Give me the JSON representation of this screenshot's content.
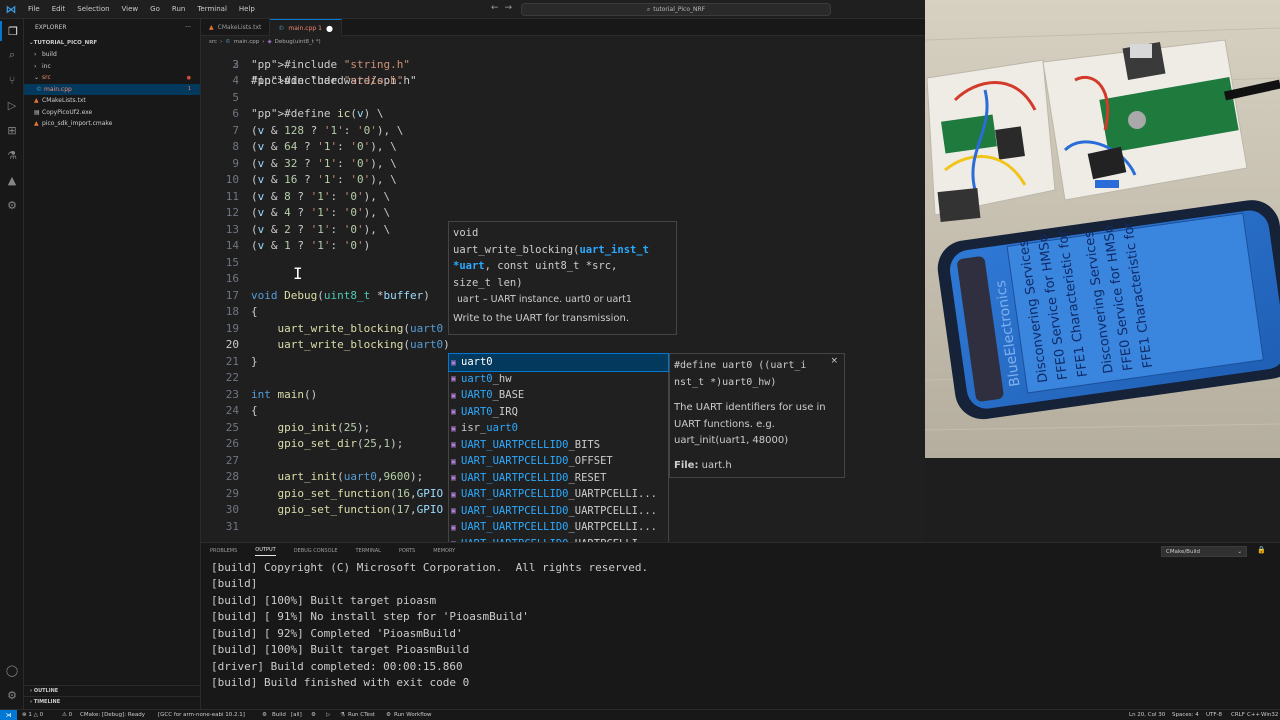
{
  "titlebar": {
    "menu": [
      "File",
      "Edit",
      "Selection",
      "View",
      "Go",
      "Run",
      "Terminal",
      "Help"
    ],
    "search": "tutorial_Pico_NRF"
  },
  "activity_icons": [
    "explorer-icon",
    "search-icon",
    "source-control-icon",
    "run-debug-icon",
    "extensions-icon",
    "testing-icon",
    "cmake-icon",
    "remote-icon"
  ],
  "sidebar": {
    "header": "EXPLORER",
    "project": "TUTORIAL_PICO_NRF",
    "items": [
      {
        "label": "build",
        "type": "folder",
        "depth": 1,
        "open": false
      },
      {
        "label": "inc",
        "type": "folder",
        "depth": 1,
        "open": false
      },
      {
        "label": "src",
        "type": "folder",
        "depth": 1,
        "open": true,
        "error": true
      },
      {
        "label": "main.cpp",
        "type": "file",
        "depth": 2,
        "selected": true,
        "error_count": "1"
      },
      {
        "label": "CMakeLists.txt",
        "type": "file",
        "depth": 1
      },
      {
        "label": "CopyPicoUf2.exe",
        "type": "file",
        "depth": 1
      },
      {
        "label": "pico_sdk_import.cmake",
        "type": "file",
        "depth": 1
      }
    ],
    "outline": "OUTLINE",
    "timeline": "TIMELINE"
  },
  "tabs": [
    {
      "label": "CMakeLists.txt",
      "active": false
    },
    {
      "label": "main.cpp 1",
      "active": true,
      "modified": true
    }
  ],
  "breadcrumb": [
    "src",
    "main.cpp",
    "Debug(uint8_t *)"
  ],
  "editor": {
    "first_line_partial": "#include \"hardware/spi.h\"",
    "lines": [
      {
        "n": "3",
        "t": "#include \"string.h\""
      },
      {
        "n": "4",
        "t": "#include \"stdio.h\""
      },
      {
        "n": "5",
        "t": ""
      },
      {
        "n": "6",
        "t": "#define ic(v) \\"
      },
      {
        "n": "7",
        "t": "(v & 128 ? '1': '0'), \\"
      },
      {
        "n": "8",
        "t": "(v & 64 ? '1': '0'), \\"
      },
      {
        "n": "9",
        "t": "(v & 32 ? '1': '0'), \\"
      },
      {
        "n": "10",
        "t": "(v & 16 ? '1': '0'), \\"
      },
      {
        "n": "11",
        "t": "(v & 8 ? '1': '0'), \\"
      },
      {
        "n": "12",
        "t": "(v & 4 ? '1': '0'), \\"
      },
      {
        "n": "13",
        "t": "(v & 2 ? '1': '0'), \\"
      },
      {
        "n": "14",
        "t": "(v & 1 ? '1': '0')"
      },
      {
        "n": "15",
        "t": ""
      },
      {
        "n": "16",
        "t": ""
      },
      {
        "n": "17",
        "t": "void Debug(uint8_t *buffer)"
      },
      {
        "n": "18",
        "t": "{"
      },
      {
        "n": "19",
        "t": "    uart_write_blocking(uart0                         1);"
      },
      {
        "n": "20",
        "t": "    uart_write_blocking(uart0)"
      },
      {
        "n": "21",
        "t": "}"
      },
      {
        "n": "22",
        "t": ""
      },
      {
        "n": "23",
        "t": "int main()"
      },
      {
        "n": "24",
        "t": "{"
      },
      {
        "n": "25",
        "t": "    gpio_init(25);"
      },
      {
        "n": "26",
        "t": "    gpio_set_dir(25,1);"
      },
      {
        "n": "27",
        "t": ""
      },
      {
        "n": "28",
        "t": "    uart_init(uart0,9600);"
      },
      {
        "n": "29",
        "t": "    gpio_set_function(16,GPIO"
      },
      {
        "n": "30",
        "t": "    gpio_set_function(17,GPIO"
      },
      {
        "n": "31",
        "t": ""
      }
    ]
  },
  "hover": {
    "sig1": "void",
    "sig2a": "uart_write_blocking(",
    "sig2b": "uart_inst_t",
    "sig3a": "*uart",
    "sig3b": ", const uint8_t *src,",
    "sig4": "size_t len)",
    "param_name": "uart",
    "param_desc": " – UART instance. uart0 or uart1",
    "desc": "Write to the UART for transmission."
  },
  "suggest": [
    {
      "hl": "uart0",
      "rest": ""
    },
    {
      "hl": "uart0",
      "rest": "_hw"
    },
    {
      "hl": "UART0",
      "rest": "_BASE"
    },
    {
      "hl": "UART0",
      "rest": "_IRQ"
    },
    {
      "pre": "isr_",
      "hl": "uart0",
      "rest": ""
    },
    {
      "hl": "UART_UARTPCELLID0",
      "rest": "_BITS"
    },
    {
      "hl": "UART_UARTPCELLID0",
      "rest": "_OFFSET"
    },
    {
      "hl": "UART_UARTPCELLID0",
      "rest": "_RESET"
    },
    {
      "hl": "UART_UARTPCELLID0",
      "rest": "_UARTPCELLI..."
    },
    {
      "hl": "UART_UARTPCELLID0",
      "rest": "_UARTPCELLI..."
    },
    {
      "hl": "UART_UARTPCELLID0",
      "rest": "_UARTPCELLI..."
    },
    {
      "hl": "UART_UARTPCELLID0",
      "rest": "_UARTPCELLI..."
    }
  ],
  "suggest_detail": {
    "def": "#define uart0 ((uart_i\nnst_t *)uart0_hw)",
    "close": "×",
    "doc": "The UART identifiers for use in UART functions. e.g. uart_init(uart1, 48000)",
    "file_label": "File:",
    "file": "uart.h"
  },
  "panel": {
    "tabs": [
      "PROBLEMS",
      "OUTPUT",
      "DEBUG CONSOLE",
      "TERMINAL",
      "PORTS",
      "MEMORY"
    ],
    "active_tab": "OUTPUT",
    "dropdown": "CMake/Build",
    "output": [
      "[build] Copyright (C) Microsoft Corporation.  All rights reserved.",
      "[build]",
      "[build] [100%] Built target pioasm",
      "[build] [ 91%] No install step for 'PioasmBuild'",
      "[build] [ 92%] Completed 'PioasmBuild'",
      "[build] [100%] Built target PioasmBuild",
      "[driver] Build completed: 00:00:15.860",
      "[build] Build finished with exit code 0"
    ]
  },
  "statusbar": {
    "errors": "⊗ 1 △ 0",
    "warnings": "⚠ 0",
    "cmake": "CMake: [Debug]: Ready",
    "kit": "[GCC for arm-none-eabi 10.2.1]",
    "build": "Build",
    "all": "[all]",
    "run_ctest": "Run CTest",
    "run_workflow": "Run Workflow",
    "position": "Ln 20, Col 30",
    "spaces": "Spaces: 4",
    "encoding": "UTF-8",
    "eol": "CRLF",
    "language": "C++",
    "platform": "Win32"
  },
  "phone_screen_lines": [
    "Disconvering Services",
    "FFE0 Service for HMSo",
    "FFE1 Characteristic for",
    "Disconvering Services",
    "FFE0 Service for HMSo",
    "FFE1 Characteristic for"
  ],
  "phone_app": "BlueElectronics"
}
